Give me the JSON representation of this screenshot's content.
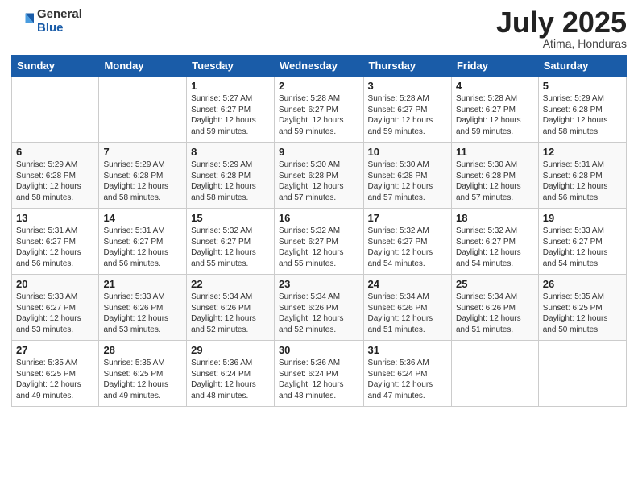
{
  "logo": {
    "general": "General",
    "blue": "Blue"
  },
  "header": {
    "month": "July 2025",
    "location": "Atima, Honduras"
  },
  "weekdays": [
    "Sunday",
    "Monday",
    "Tuesday",
    "Wednesday",
    "Thursday",
    "Friday",
    "Saturday"
  ],
  "weeks": [
    [
      {
        "day": "",
        "info": ""
      },
      {
        "day": "",
        "info": ""
      },
      {
        "day": "1",
        "info": "Sunrise: 5:27 AM\nSunset: 6:27 PM\nDaylight: 12 hours\nand 59 minutes."
      },
      {
        "day": "2",
        "info": "Sunrise: 5:28 AM\nSunset: 6:27 PM\nDaylight: 12 hours\nand 59 minutes."
      },
      {
        "day": "3",
        "info": "Sunrise: 5:28 AM\nSunset: 6:27 PM\nDaylight: 12 hours\nand 59 minutes."
      },
      {
        "day": "4",
        "info": "Sunrise: 5:28 AM\nSunset: 6:27 PM\nDaylight: 12 hours\nand 59 minutes."
      },
      {
        "day": "5",
        "info": "Sunrise: 5:29 AM\nSunset: 6:28 PM\nDaylight: 12 hours\nand 58 minutes."
      }
    ],
    [
      {
        "day": "6",
        "info": "Sunrise: 5:29 AM\nSunset: 6:28 PM\nDaylight: 12 hours\nand 58 minutes."
      },
      {
        "day": "7",
        "info": "Sunrise: 5:29 AM\nSunset: 6:28 PM\nDaylight: 12 hours\nand 58 minutes."
      },
      {
        "day": "8",
        "info": "Sunrise: 5:29 AM\nSunset: 6:28 PM\nDaylight: 12 hours\nand 58 minutes."
      },
      {
        "day": "9",
        "info": "Sunrise: 5:30 AM\nSunset: 6:28 PM\nDaylight: 12 hours\nand 57 minutes."
      },
      {
        "day": "10",
        "info": "Sunrise: 5:30 AM\nSunset: 6:28 PM\nDaylight: 12 hours\nand 57 minutes."
      },
      {
        "day": "11",
        "info": "Sunrise: 5:30 AM\nSunset: 6:28 PM\nDaylight: 12 hours\nand 57 minutes."
      },
      {
        "day": "12",
        "info": "Sunrise: 5:31 AM\nSunset: 6:28 PM\nDaylight: 12 hours\nand 56 minutes."
      }
    ],
    [
      {
        "day": "13",
        "info": "Sunrise: 5:31 AM\nSunset: 6:27 PM\nDaylight: 12 hours\nand 56 minutes."
      },
      {
        "day": "14",
        "info": "Sunrise: 5:31 AM\nSunset: 6:27 PM\nDaylight: 12 hours\nand 56 minutes."
      },
      {
        "day": "15",
        "info": "Sunrise: 5:32 AM\nSunset: 6:27 PM\nDaylight: 12 hours\nand 55 minutes."
      },
      {
        "day": "16",
        "info": "Sunrise: 5:32 AM\nSunset: 6:27 PM\nDaylight: 12 hours\nand 55 minutes."
      },
      {
        "day": "17",
        "info": "Sunrise: 5:32 AM\nSunset: 6:27 PM\nDaylight: 12 hours\nand 54 minutes."
      },
      {
        "day": "18",
        "info": "Sunrise: 5:32 AM\nSunset: 6:27 PM\nDaylight: 12 hours\nand 54 minutes."
      },
      {
        "day": "19",
        "info": "Sunrise: 5:33 AM\nSunset: 6:27 PM\nDaylight: 12 hours\nand 54 minutes."
      }
    ],
    [
      {
        "day": "20",
        "info": "Sunrise: 5:33 AM\nSunset: 6:27 PM\nDaylight: 12 hours\nand 53 minutes."
      },
      {
        "day": "21",
        "info": "Sunrise: 5:33 AM\nSunset: 6:26 PM\nDaylight: 12 hours\nand 53 minutes."
      },
      {
        "day": "22",
        "info": "Sunrise: 5:34 AM\nSunset: 6:26 PM\nDaylight: 12 hours\nand 52 minutes."
      },
      {
        "day": "23",
        "info": "Sunrise: 5:34 AM\nSunset: 6:26 PM\nDaylight: 12 hours\nand 52 minutes."
      },
      {
        "day": "24",
        "info": "Sunrise: 5:34 AM\nSunset: 6:26 PM\nDaylight: 12 hours\nand 51 minutes."
      },
      {
        "day": "25",
        "info": "Sunrise: 5:34 AM\nSunset: 6:26 PM\nDaylight: 12 hours\nand 51 minutes."
      },
      {
        "day": "26",
        "info": "Sunrise: 5:35 AM\nSunset: 6:25 PM\nDaylight: 12 hours\nand 50 minutes."
      }
    ],
    [
      {
        "day": "27",
        "info": "Sunrise: 5:35 AM\nSunset: 6:25 PM\nDaylight: 12 hours\nand 49 minutes."
      },
      {
        "day": "28",
        "info": "Sunrise: 5:35 AM\nSunset: 6:25 PM\nDaylight: 12 hours\nand 49 minutes."
      },
      {
        "day": "29",
        "info": "Sunrise: 5:36 AM\nSunset: 6:24 PM\nDaylight: 12 hours\nand 48 minutes."
      },
      {
        "day": "30",
        "info": "Sunrise: 5:36 AM\nSunset: 6:24 PM\nDaylight: 12 hours\nand 48 minutes."
      },
      {
        "day": "31",
        "info": "Sunrise: 5:36 AM\nSunset: 6:24 PM\nDaylight: 12 hours\nand 47 minutes."
      },
      {
        "day": "",
        "info": ""
      },
      {
        "day": "",
        "info": ""
      }
    ]
  ]
}
